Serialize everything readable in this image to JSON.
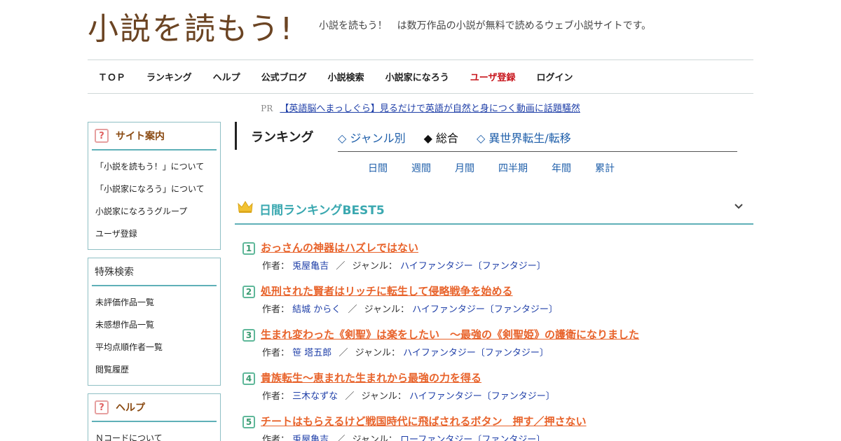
{
  "header": {
    "logo_text": "小説を読もう!",
    "tagline": "小説を読もう！　は数万作品の小説が無料で読めるウェブ小説サイトです。"
  },
  "nav": [
    {
      "label": "ＴＯＰ"
    },
    {
      "label": "ランキング"
    },
    {
      "label": "ヘルプ"
    },
    {
      "label": "公式ブログ"
    },
    {
      "label": "小説検索"
    },
    {
      "label": "小説家になろう"
    },
    {
      "label": "ユーザ登録"
    },
    {
      "label": "ログイン"
    }
  ],
  "pr": {
    "label": "PR",
    "link": "【英語脳へまっしぐら】見るだけで英語が自然と身につく動画に話題騒然"
  },
  "sidebar": {
    "site_guide": {
      "title": "サイト案内",
      "items": [
        "「小説を読もう！」について",
        "「小説家になろう」について",
        "小説家になろうグループ",
        "ユーザ登録"
      ]
    },
    "special_search": {
      "title": "特殊検索",
      "items": [
        "未評価作品一覧",
        "未感想作品一覧",
        "平均点順作者一覧",
        "閲覧履歴"
      ]
    },
    "help": {
      "title": "ヘルプ",
      "items": [
        "Ｎコードについて"
      ]
    }
  },
  "main": {
    "ranking_label": "ランキング",
    "tabs": [
      "◇ ジャンル別",
      "◆ 総合",
      "◇ 異世界転生/転移"
    ],
    "active_tab": 1,
    "periods": [
      "日間",
      "週間",
      "月間",
      "四半期",
      "年間",
      "累計"
    ],
    "section_title": "日間ランキングBEST5",
    "author_label": "作者：",
    "genre_label": "ジャンル：",
    "separator": "／",
    "ranking": [
      {
        "rank": "1",
        "title": "おっさんの神器はハズレではない",
        "author": "兎屋亀吉",
        "genre": "ハイファンタジー〔ファンタジー〕"
      },
      {
        "rank": "2",
        "title": "処刑された賢者はリッチに転生して侵略戦争を始める",
        "author": "結城 からく",
        "genre": "ハイファンタジー〔ファンタジー〕"
      },
      {
        "rank": "3",
        "title": "生まれ変わった《剣聖》は楽をしたい　～最強の《剣聖姫》の護衛になりました",
        "author": "笹 塔五郎",
        "genre": "ハイファンタジー〔ファンタジー〕"
      },
      {
        "rank": "4",
        "title": "貴族転生～恵まれた生まれから最強の力を得る",
        "author": "三木なずな",
        "genre": "ハイファンタジー〔ファンタジー〕"
      },
      {
        "rank": "5",
        "title": "チートはもらえるけど戦国時代に飛ばされるボタン　押す／押さない",
        "author": "兎屋亀吉",
        "genre": "ローファンタジー〔ファンタジー〕"
      }
    ]
  },
  "colors": {
    "logo": "#6b4423",
    "accent_teal": "#3aa8b0",
    "title_orange": "#e8632b",
    "link_blue": "#1f3fa8",
    "register_red": "#c8161d"
  }
}
